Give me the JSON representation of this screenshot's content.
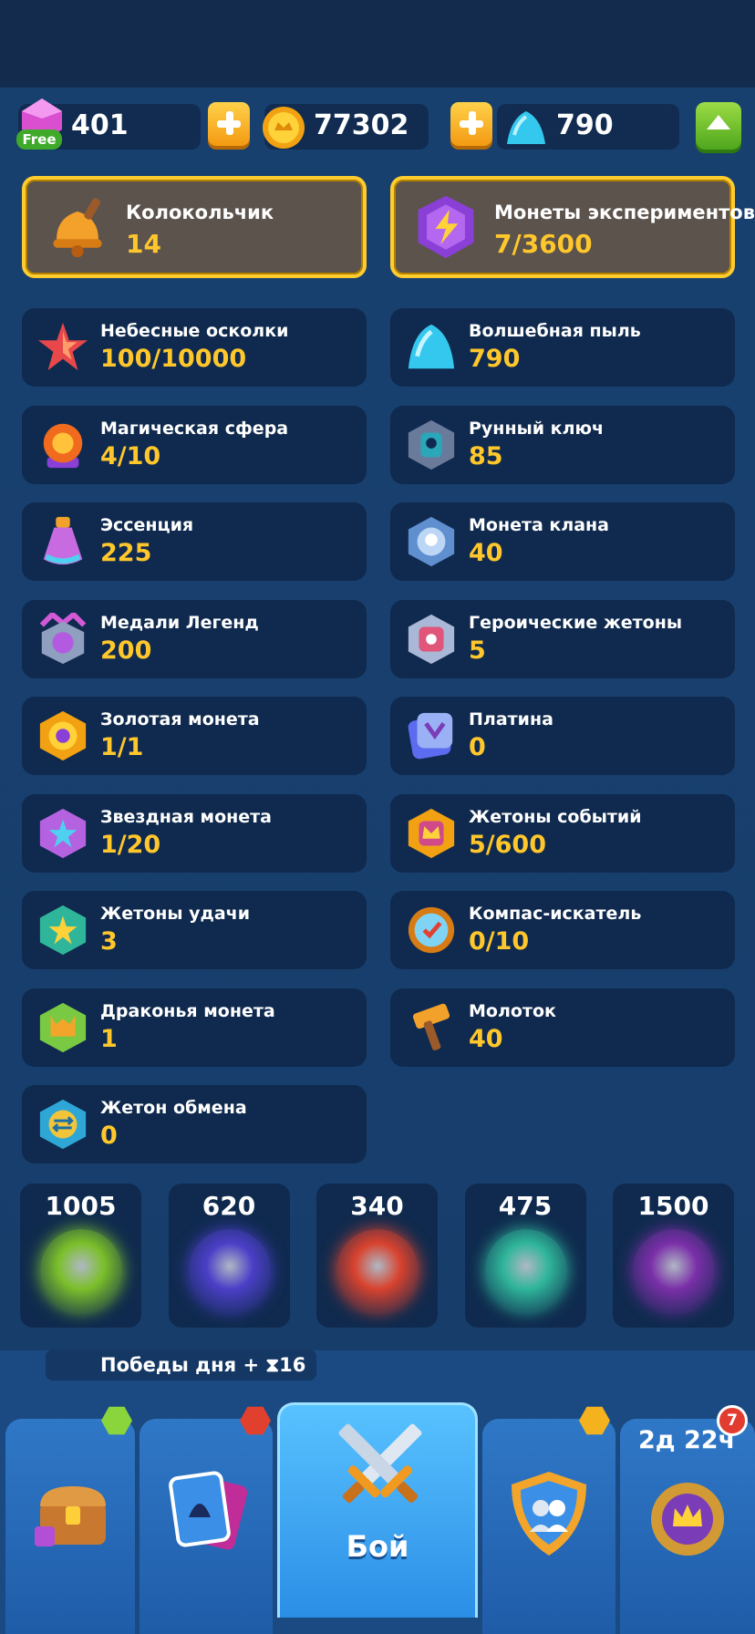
{
  "currency": {
    "gems": "401",
    "gems_free_label": "Free",
    "coins": "77302",
    "dust": "790"
  },
  "highlighted": [
    {
      "name": "Колокольчик",
      "value": "14",
      "icon": "bell-icon"
    },
    {
      "name": "Монеты экспериментов",
      "value": "7/3600",
      "icon": "lightning-coin-icon"
    }
  ],
  "resources": [
    {
      "name": "Небесные осколки",
      "value": "100/10000",
      "icon": "star-shard-icon"
    },
    {
      "name": "Волшебная пыль",
      "value": "790",
      "icon": "magic-dust-icon"
    },
    {
      "name": "Магическая сфера",
      "value": "4/10",
      "icon": "magic-sphere-icon"
    },
    {
      "name": "Рунный ключ",
      "value": "85",
      "icon": "rune-key-icon"
    },
    {
      "name": "Эссенция",
      "value": "225",
      "icon": "essence-potion-icon"
    },
    {
      "name": "Монета клана",
      "value": "40",
      "icon": "clan-coin-icon"
    },
    {
      "name": "Медали Легенд",
      "value": "200",
      "icon": "legend-medal-icon"
    },
    {
      "name": "Героические жетоны",
      "value": "5",
      "icon": "heroic-token-icon"
    },
    {
      "name": "Золотая монета",
      "value": "1/1",
      "icon": "gold-coin-icon"
    },
    {
      "name": "Платина",
      "value": "0",
      "icon": "platinum-icon"
    },
    {
      "name": "Звездная монета",
      "value": "1/20",
      "icon": "star-coin-icon"
    },
    {
      "name": "Жетоны событий",
      "value": "5/600",
      "icon": "event-token-icon"
    },
    {
      "name": "Жетоны удачи",
      "value": "3",
      "icon": "luck-token-icon"
    },
    {
      "name": "Компас-искатель",
      "value": "0/10",
      "icon": "compass-icon"
    },
    {
      "name": "Драконья монета",
      "value": "1",
      "icon": "dragon-coin-icon"
    },
    {
      "name": "Молоток",
      "value": "40",
      "icon": "hammer-icon"
    },
    {
      "name": "Жетон обмена",
      "value": "0",
      "icon": "exchange-token-icon"
    }
  ],
  "tokens": [
    {
      "value": "1005",
      "icon": "nature-orb-icon",
      "color": "#7bbf2a"
    },
    {
      "value": "620",
      "icon": "eight-ball-orb-icon",
      "color": "#4b3fc7"
    },
    {
      "value": "340",
      "icon": "lightbulb-orb-icon",
      "color": "#d8422e"
    },
    {
      "value": "475",
      "icon": "eagle-orb-icon",
      "color": "#2fb59a"
    },
    {
      "value": "1500",
      "icon": "bat-orb-icon",
      "color": "#7a2fa8"
    }
  ],
  "daily_wins": {
    "label": "Победы дня",
    "bonus": "+ ⧗16"
  },
  "nav": {
    "battle_label": "Бой",
    "timer": "2д 22ч",
    "badge_count": "7"
  }
}
